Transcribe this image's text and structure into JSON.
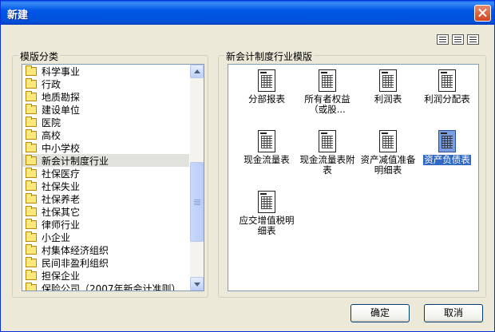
{
  "window": {
    "title": "新建"
  },
  "view_icons": [
    "large-icons-view-icon",
    "list-view-icon",
    "details-view-icon"
  ],
  "left_group": {
    "legend": "模版分类",
    "items": [
      {
        "label": "科学事业"
      },
      {
        "label": "行政"
      },
      {
        "label": "地质勘探"
      },
      {
        "label": "建设单位"
      },
      {
        "label": "医院"
      },
      {
        "label": "高校"
      },
      {
        "label": "中小学校"
      },
      {
        "label": "新会计制度行业",
        "selected": true
      },
      {
        "label": "社保医疗"
      },
      {
        "label": "社保失业"
      },
      {
        "label": "社保养老"
      },
      {
        "label": "社保其它"
      },
      {
        "label": "律师行业"
      },
      {
        "label": "小企业"
      },
      {
        "label": "村集体经济组织"
      },
      {
        "label": "民间非盈利组织"
      },
      {
        "label": "担保企业"
      },
      {
        "label": "保险公司（2007年新会计准则）"
      }
    ]
  },
  "right_group": {
    "legend": "新会计制度行业模版",
    "items": [
      {
        "label": "分部报表"
      },
      {
        "label": "所有者权益（或股..."
      },
      {
        "label": "利润表"
      },
      {
        "label": "利润分配表"
      },
      {
        "label": "现金流量表"
      },
      {
        "label": "现金流量表附表"
      },
      {
        "label": "资产减值准备明细表"
      },
      {
        "label": "资产负债表",
        "selected": true
      },
      {
        "label": "应交增值税明细表"
      }
    ]
  },
  "buttons": {
    "ok": "确定",
    "cancel": "取消"
  },
  "colors": {
    "titlebar": "#0058E6",
    "selection": "#316AC5",
    "dialog_bg": "#ECE9D8"
  }
}
